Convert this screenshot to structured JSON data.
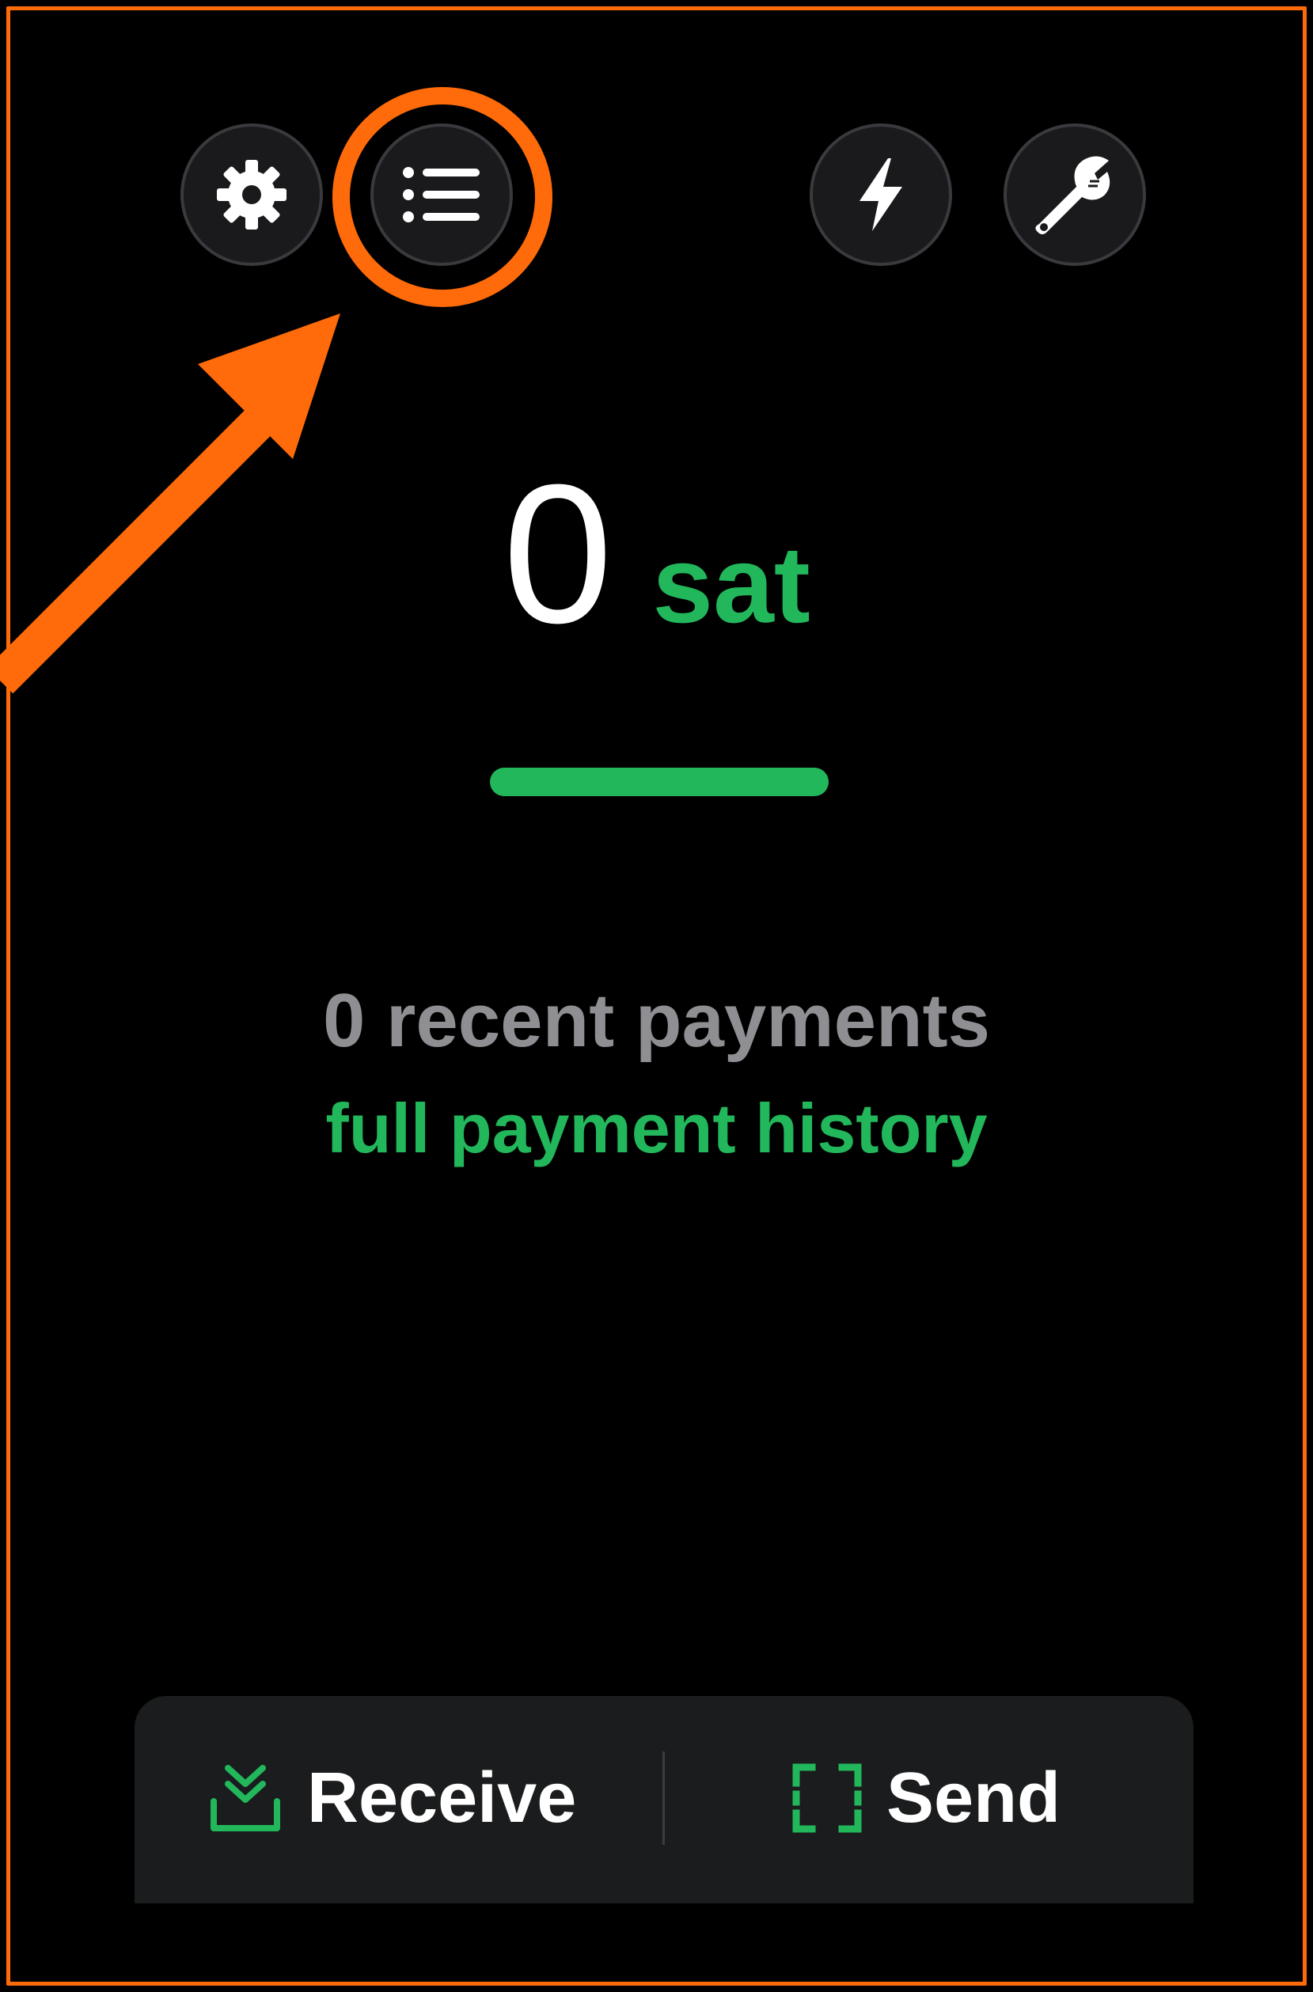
{
  "balance": {
    "amount": "0",
    "unit": "sat"
  },
  "payments": {
    "count_label": "0 recent payments",
    "history_link": "full payment history"
  },
  "actions": {
    "receive_label": "Receive",
    "send_label": "Send"
  },
  "icons": {
    "settings": "gear-icon",
    "list": "list-icon",
    "lightning": "lightning-bolt-icon",
    "tools": "wrench-icon",
    "receive": "download-check-icon",
    "send": "scan-frame-icon"
  },
  "colors": {
    "background": "#000000",
    "accent": "#22b75b",
    "highlight": "#ff6b0a",
    "muted_text": "#8e8e93",
    "button_bg": "#1a1a1c"
  }
}
